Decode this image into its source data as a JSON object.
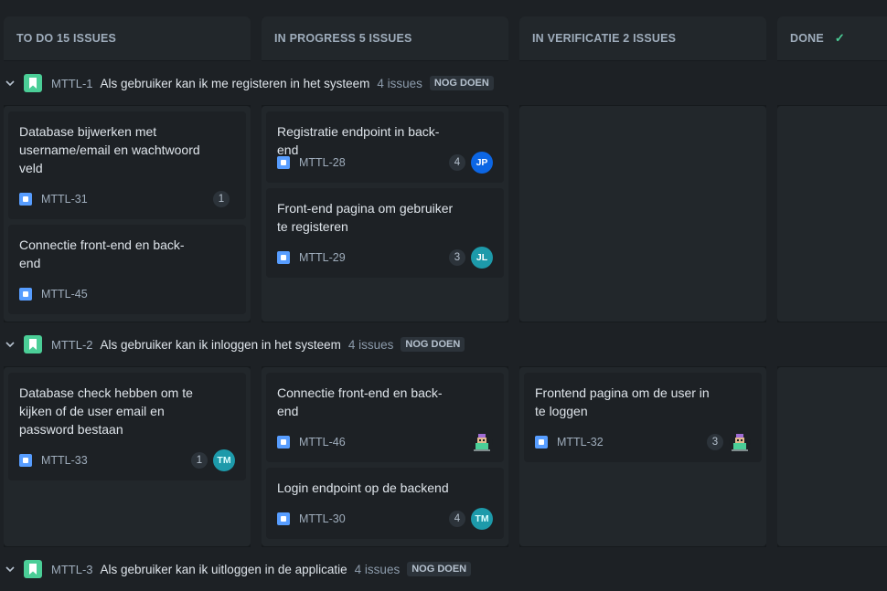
{
  "columns": [
    {
      "label": "TO DO 15 ISSUES"
    },
    {
      "label": "IN PROGRESS 5 ISSUES"
    },
    {
      "label": "IN VERIFICATIE 2 ISSUES"
    },
    {
      "label": "DONE"
    }
  ],
  "swimlanes": [
    {
      "key": "MTTL-1",
      "title": "Als gebruiker kan ik me registeren in het systeem",
      "count": "4 issues",
      "status": "NOG DOEN"
    },
    {
      "key": "MTTL-2",
      "title": "Als gebruiker kan ik inloggen in het systeem",
      "count": "4 issues",
      "status": "NOG DOEN"
    },
    {
      "key": "MTTL-3",
      "title": "Als gebruiker kan ik uitloggen in de applicatie",
      "count": "4 issues",
      "status": "NOG DOEN"
    }
  ],
  "cards": {
    "c31": {
      "summary": "Database bijwerken met username/email en wachtwoord veld",
      "key": "MTTL-31",
      "points": "1"
    },
    "c45": {
      "summary": "Connectie front-end en back-end",
      "key": "MTTL-45"
    },
    "c28": {
      "summary": "Registratie endpoint in back-end",
      "key": "MTTL-28",
      "points": "4",
      "assignee": "JP"
    },
    "c29": {
      "summary": "Front-end pagina om gebruiker te registeren",
      "key": "MTTL-29",
      "points": "3",
      "assignee": "JL"
    },
    "c33": {
      "summary": "Database check hebben om te kijken of de user email en password bestaan",
      "key": "MTTL-33",
      "points": "1",
      "assignee": "TM"
    },
    "c46": {
      "summary": "Connectie front-end en back-end",
      "key": "MTTL-46"
    },
    "c30": {
      "summary": "Login endpoint op de backend",
      "key": "MTTL-30",
      "points": "4",
      "assignee": "TM"
    },
    "c32": {
      "summary": "Frontend pagina om de user in te loggen",
      "key": "MTTL-32",
      "points": "3"
    }
  },
  "colors": {
    "background": "#1d2125",
    "epic": "#4bce97",
    "story": "#579dff",
    "done_check": "#4bce97"
  },
  "icons": {
    "done": "check-icon",
    "epic": "bookmark-icon",
    "story": "story-icon",
    "collapse": "chevron-down-icon"
  }
}
